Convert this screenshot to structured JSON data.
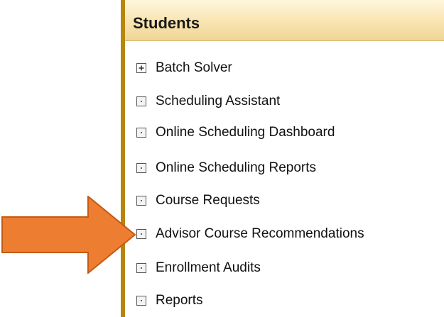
{
  "panel": {
    "title": "Students"
  },
  "menu": {
    "items": [
      {
        "label": "Batch Solver",
        "icon": "plus-box-icon"
      },
      {
        "label": "Scheduling Assistant",
        "icon": "dot-box-icon"
      },
      {
        "label": "Online Scheduling Dashboard",
        "icon": "dot-box-icon"
      },
      {
        "label": "Online Scheduling Reports",
        "icon": "dot-box-icon"
      },
      {
        "label": "Course Requests",
        "icon": "dot-box-icon"
      },
      {
        "label": "Advisor Course Recommendations",
        "icon": "dot-box-icon"
      },
      {
        "label": "Enrollment Audits",
        "icon": "dot-box-icon"
      },
      {
        "label": "Reports",
        "icon": "dot-box-icon"
      }
    ]
  },
  "colors": {
    "panel_border": "#b8860b",
    "header_gradient_top": "#fff6dc",
    "header_gradient_bottom": "#f1d596",
    "arrow_fill": "#ed7d31",
    "arrow_stroke": "#c55a11"
  }
}
